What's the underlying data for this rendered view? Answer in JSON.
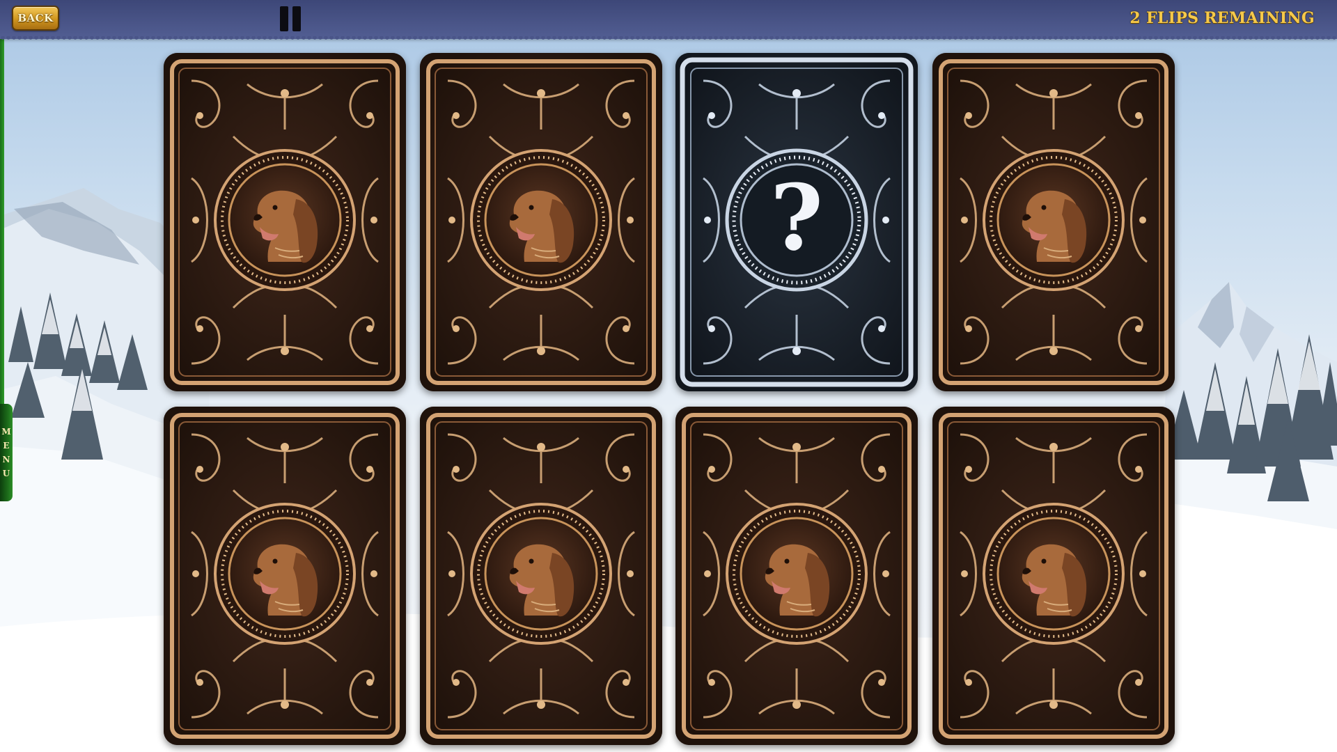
{
  "topbar": {
    "back_label": "BACK",
    "flips_remaining_text": "2 FLIPS REMAINING"
  },
  "side_menu": {
    "letters": [
      "M",
      "E",
      "N",
      "U"
    ]
  },
  "colors": {
    "topbar": "#4a5588",
    "gold_text": "#f6c94a",
    "card_brown": "#2a1810",
    "card_gold_trim": "#c8935a",
    "card_silver_trim": "#b8c6d8",
    "menu_green": "#1c6b1a"
  },
  "board": {
    "rows": 2,
    "columns": 4,
    "cards": [
      {
        "state": "face-down",
        "design": "dog-portrait"
      },
      {
        "state": "face-down",
        "design": "dog-portrait"
      },
      {
        "state": "highlighted",
        "design": "question-mark",
        "symbol": "?"
      },
      {
        "state": "face-down",
        "design": "dog-portrait"
      },
      {
        "state": "face-down",
        "design": "dog-portrait"
      },
      {
        "state": "face-down",
        "design": "dog-portrait"
      },
      {
        "state": "face-down",
        "design": "dog-portrait"
      },
      {
        "state": "face-down",
        "design": "dog-portrait"
      }
    ]
  }
}
